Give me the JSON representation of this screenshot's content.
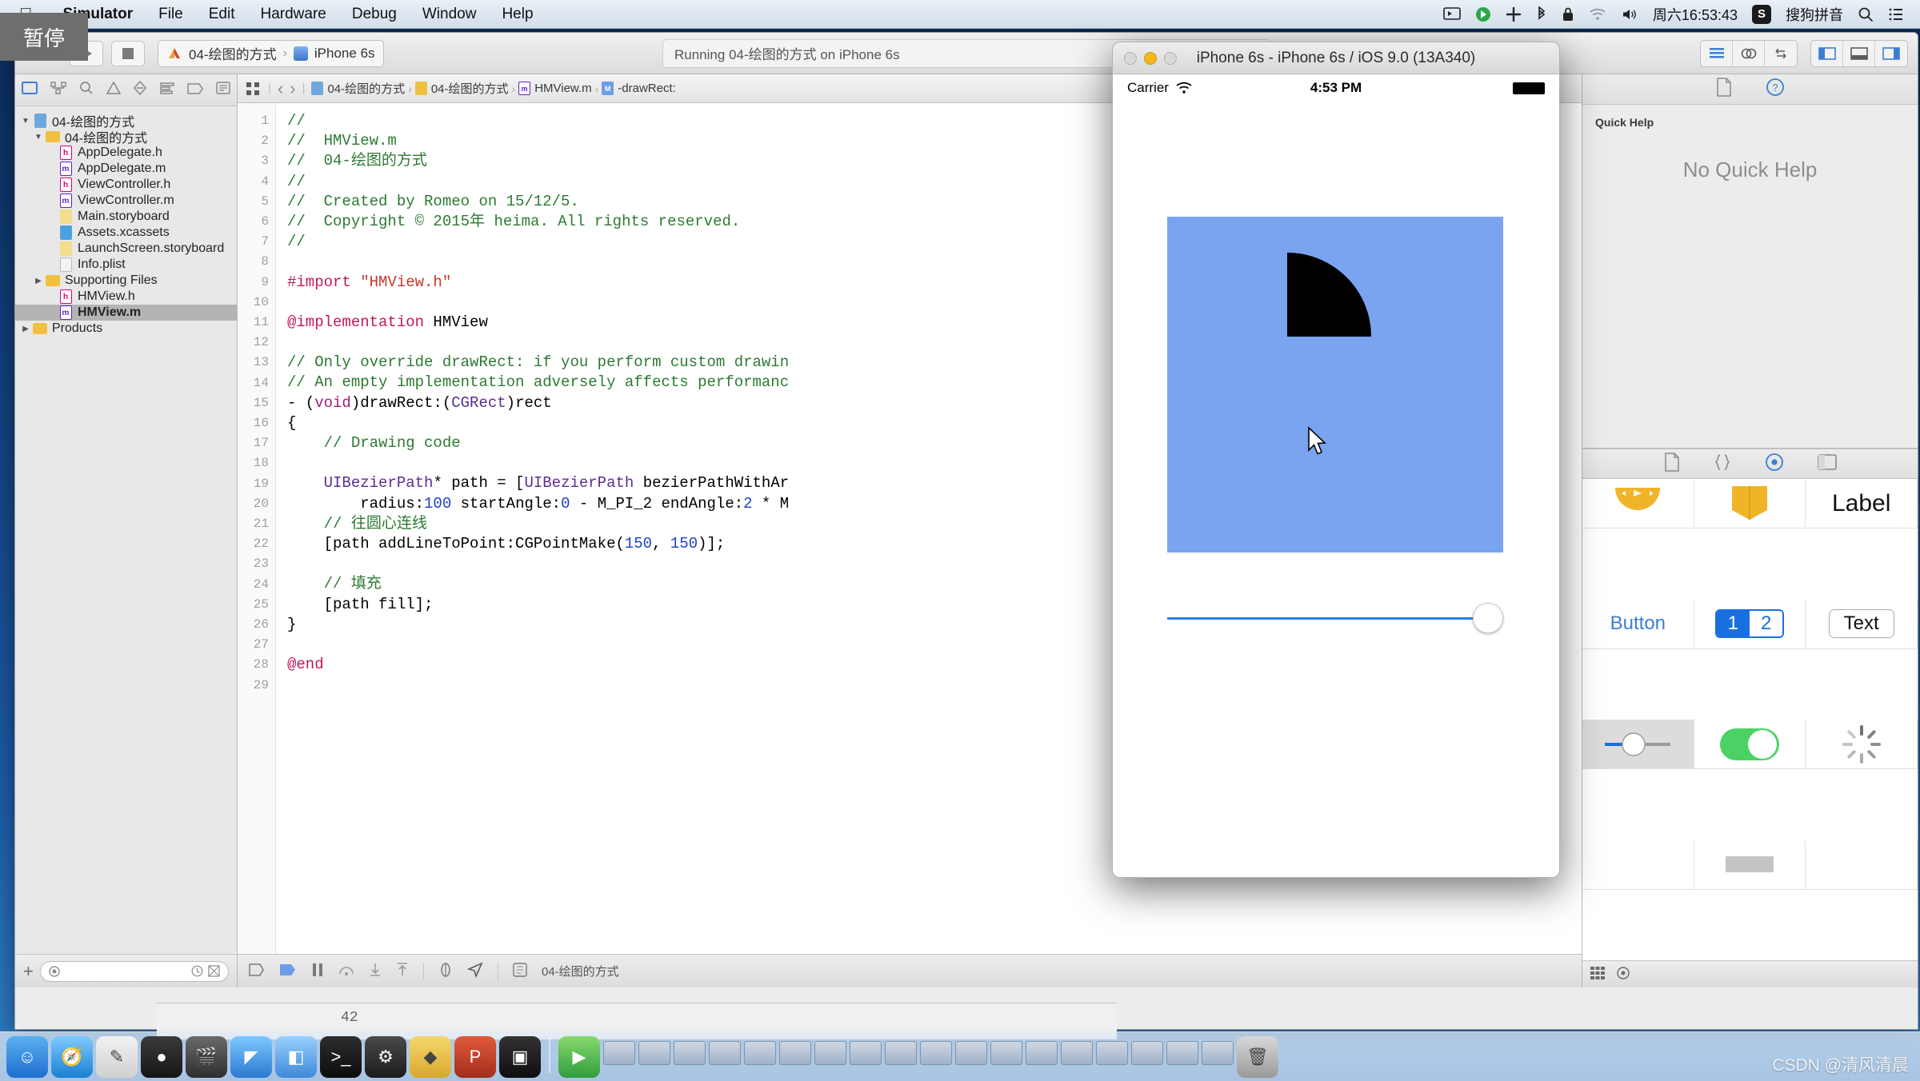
{
  "menubar": {
    "apple_icon": "apple-logo",
    "items": [
      "Simulator",
      "File",
      "Edit",
      "Hardware",
      "Debug",
      "Window",
      "Help"
    ],
    "status_icons": [
      "screen-share-icon",
      "record-icon",
      "dropbox-icon",
      "bluetooth-icon",
      "lock-icon",
      "wifi-icon",
      "volume-icon"
    ],
    "clock": "周六16:53:43",
    "input_method_badge": "S",
    "input_method": "搜狗拼音",
    "search_icon": "search-icon",
    "notification_icon": "notification-center-icon"
  },
  "tooltip": {
    "pause_label": "暂停"
  },
  "toolbar": {
    "run_icon": "play-icon",
    "stop_icon": "stop-icon",
    "scheme_name": "04-绘图的方式",
    "scheme_separator": "›",
    "destination": "iPhone 6s",
    "activity_status": "Running 04-绘图的方式 on iPhone 6s",
    "editor_segments": [
      "standard-editor-icon",
      "assistant-editor-icon",
      "version-editor-icon"
    ],
    "view_segments": [
      "navigator-toggle-icon",
      "debug-toggle-icon",
      "utilities-toggle-icon"
    ]
  },
  "navigator": {
    "tabs": [
      "project-navigator-icon",
      "symbol-navigator-icon",
      "search-navigator-icon",
      "issue-navigator-icon",
      "test-navigator-icon",
      "debug-navigator-icon",
      "breakpoint-navigator-icon",
      "report-navigator-icon"
    ],
    "tree": [
      {
        "label": "04-绘图的方式",
        "indent": 0,
        "twisty": "▼",
        "icon": "project-icon",
        "kind": "proj",
        "selected": false
      },
      {
        "label": "04-绘图的方式",
        "indent": 1,
        "twisty": "▼",
        "icon": "folder-icon",
        "kind": "folder",
        "selected": false
      },
      {
        "label": "AppDelegate.h",
        "indent": 2,
        "twisty": "",
        "icon": "header-file-icon",
        "kind": "h",
        "selected": false
      },
      {
        "label": "AppDelegate.m",
        "indent": 2,
        "twisty": "",
        "icon": "objc-file-icon",
        "kind": "m",
        "selected": false
      },
      {
        "label": "ViewController.h",
        "indent": 2,
        "twisty": "",
        "icon": "header-file-icon",
        "kind": "h",
        "selected": false
      },
      {
        "label": "ViewController.m",
        "indent": 2,
        "twisty": "",
        "icon": "objc-file-icon",
        "kind": "m",
        "selected": false
      },
      {
        "label": "Main.storyboard",
        "indent": 2,
        "twisty": "",
        "icon": "storyboard-icon",
        "kind": "sb",
        "selected": false
      },
      {
        "label": "Assets.xcassets",
        "indent": 2,
        "twisty": "",
        "icon": "assets-icon",
        "kind": "xc",
        "selected": false
      },
      {
        "label": "LaunchScreen.storyboard",
        "indent": 2,
        "twisty": "",
        "icon": "storyboard-icon",
        "kind": "sb",
        "selected": false
      },
      {
        "label": "Info.plist",
        "indent": 2,
        "twisty": "",
        "icon": "plist-icon",
        "kind": "pl",
        "selected": false
      },
      {
        "label": "Supporting Files",
        "indent": 1,
        "twisty": "▶",
        "icon": "folder-icon",
        "kind": "folder",
        "selected": false
      },
      {
        "label": "HMView.h",
        "indent": 2,
        "twisty": "",
        "icon": "header-file-icon",
        "kind": "h",
        "selected": false
      },
      {
        "label": "HMView.m",
        "indent": 2,
        "twisty": "",
        "icon": "objc-file-icon",
        "kind": "m",
        "selected": true
      },
      {
        "label": "Products",
        "indent": 0,
        "twisty": "▶",
        "icon": "folder-icon",
        "kind": "folder",
        "selected": false
      }
    ],
    "add_button": "+",
    "filter_placeholder": "",
    "filter_icons": [
      "recent-filter-icon",
      "sourcecontrol-filter-icon"
    ]
  },
  "jumpbar": {
    "related_icon": "related-items-icon",
    "back_icon": "‹",
    "forward_icon": "›",
    "crumbs": [
      {
        "label": "04-绘图的方式",
        "kind": "proj"
      },
      {
        "label": "04-绘图的方式",
        "kind": "folder"
      },
      {
        "label": "HMView.m",
        "kind": "m"
      },
      {
        "label": "-drawRect:",
        "kind": "method"
      }
    ]
  },
  "code": {
    "first_line": 1,
    "last_line": 29,
    "lines": [
      {
        "n": 1,
        "tokens": [
          [
            "c-com",
            "//"
          ]
        ]
      },
      {
        "n": 2,
        "tokens": [
          [
            "c-com",
            "//  HMView.m"
          ]
        ]
      },
      {
        "n": 3,
        "tokens": [
          [
            "c-com",
            "//  04-绘图的方式"
          ]
        ]
      },
      {
        "n": 4,
        "tokens": [
          [
            "c-com",
            "//"
          ]
        ]
      },
      {
        "n": 5,
        "tokens": [
          [
            "c-com",
            "//  Created by Romeo on 15/12/5."
          ]
        ]
      },
      {
        "n": 6,
        "tokens": [
          [
            "c-com",
            "//  Copyright © 2015年 heima. All rights reserved."
          ]
        ]
      },
      {
        "n": 7,
        "tokens": [
          [
            "c-com",
            "//"
          ]
        ]
      },
      {
        "n": 8,
        "tokens": []
      },
      {
        "n": 9,
        "tokens": [
          [
            "c-pre",
            "#import "
          ],
          [
            "c-str",
            "\"HMView.h\""
          ]
        ]
      },
      {
        "n": 10,
        "tokens": []
      },
      {
        "n": 11,
        "tokens": [
          [
            "c-pre",
            "@implementation"
          ],
          [
            "c-ident",
            " HMView"
          ]
        ]
      },
      {
        "n": 12,
        "tokens": []
      },
      {
        "n": 13,
        "tokens": [
          [
            "c-com",
            "// Only override drawRect: if you perform custom drawin"
          ]
        ]
      },
      {
        "n": 14,
        "tokens": [
          [
            "c-com",
            "// An empty implementation adversely affects performanc"
          ]
        ]
      },
      {
        "n": 15,
        "tokens": [
          [
            "c-ident",
            "- ("
          ],
          [
            "c-kw",
            "void"
          ],
          [
            "c-ident",
            ")drawRect:("
          ],
          [
            "c-type",
            "CGRect"
          ],
          [
            "c-ident",
            ")rect"
          ]
        ]
      },
      {
        "n": 16,
        "tokens": [
          [
            "c-ident",
            "{"
          ]
        ]
      },
      {
        "n": 17,
        "tokens": [
          [
            "c-com",
            "    // Drawing code"
          ]
        ]
      },
      {
        "n": 18,
        "tokens": []
      },
      {
        "n": 19,
        "tokens": [
          [
            "c-type",
            "    UIBezierPath"
          ],
          [
            "c-ident",
            "* path = ["
          ],
          [
            "c-type",
            "UIBezierPath"
          ],
          [
            "c-ident",
            " bezierPathWithAr"
          ]
        ]
      },
      {
        "n": 20,
        "tokens": [
          [
            "c-ident",
            "        radius:"
          ],
          [
            "c-num",
            "100"
          ],
          [
            "c-ident",
            " startAngle:"
          ],
          [
            "c-num",
            "0"
          ],
          [
            "c-ident",
            " - M_PI_2 endAngle:"
          ],
          [
            "c-num",
            "2"
          ],
          [
            "c-ident",
            " * M"
          ]
        ]
      },
      {
        "n": 21,
        "tokens": [
          [
            "c-com",
            "    // 往圆心连线"
          ]
        ]
      },
      {
        "n": 22,
        "tokens": [
          [
            "c-ident",
            "    [path addLineToPoint:CGPointMake("
          ],
          [
            "c-num",
            "150"
          ],
          [
            "c-ident",
            ", "
          ],
          [
            "c-num",
            "150"
          ],
          [
            "c-ident",
            ")];"
          ]
        ]
      },
      {
        "n": 23,
        "tokens": []
      },
      {
        "n": 24,
        "tokens": [
          [
            "c-com",
            "    // 填充"
          ]
        ]
      },
      {
        "n": 25,
        "tokens": [
          [
            "c-ident",
            "    [path fill];"
          ]
        ]
      },
      {
        "n": 26,
        "tokens": [
          [
            "c-ident",
            "}"
          ]
        ]
      },
      {
        "n": 27,
        "tokens": []
      },
      {
        "n": 28,
        "tokens": [
          [
            "c-pre",
            "@end"
          ]
        ]
      },
      {
        "n": 29,
        "tokens": []
      }
    ]
  },
  "editor_bottom": {
    "icons": [
      "breakpoint-toggle-icon",
      "continue-icon",
      "pause-icon",
      "step-over-icon",
      "step-into-icon",
      "step-out-icon",
      "view-debug-icon",
      "location-icon",
      "process-icon"
    ],
    "process_label": "04-绘图的方式"
  },
  "debug_area": {
    "line_value": "42"
  },
  "utilities": {
    "inspector_tabs": [
      "file-inspector-icon",
      "quick-help-icon"
    ],
    "quick_help_title": "Quick Help",
    "quick_help_empty": "No Quick Help",
    "library_tabs": [
      "file-template-library-icon",
      "code-snippet-library-icon",
      "object-library-icon",
      "media-library-icon"
    ],
    "library_items": [
      {
        "name": "player-control-icon",
        "label": ""
      },
      {
        "name": "collection-view-icon",
        "label": ""
      },
      {
        "name": "label-object",
        "label": "Label"
      },
      {
        "name": "button-object",
        "label": "Button"
      },
      {
        "name": "segmented-control-object",
        "labels": [
          "1",
          "2"
        ]
      },
      {
        "name": "text-field-object",
        "label": "Text"
      },
      {
        "name": "slider-object",
        "label": ""
      },
      {
        "name": "switch-object",
        "label": ""
      },
      {
        "name": "activity-indicator-object",
        "label": ""
      }
    ],
    "bottom_icons": [
      "grid-view-icon",
      "list-view-icon"
    ]
  },
  "simulator": {
    "title": "iPhone 6s - iPhone 6s / iOS 9.0 (13A340)",
    "traffic_lights": [
      "close-button",
      "minimize-button",
      "zoom-button"
    ],
    "ios_status": {
      "carrier": "Carrier",
      "wifi_icon": "wifi-icon",
      "time": "4:53 PM",
      "battery_icon": "battery-icon"
    },
    "canvas": {
      "background_color": "#7aa3f0",
      "shape": "filled-pie-wedge",
      "shape_color": "#000000"
    },
    "slider": {
      "value_position": "right",
      "track_color": "#2f7fe0"
    }
  },
  "watermark": "CSDN @清风清晨"
}
